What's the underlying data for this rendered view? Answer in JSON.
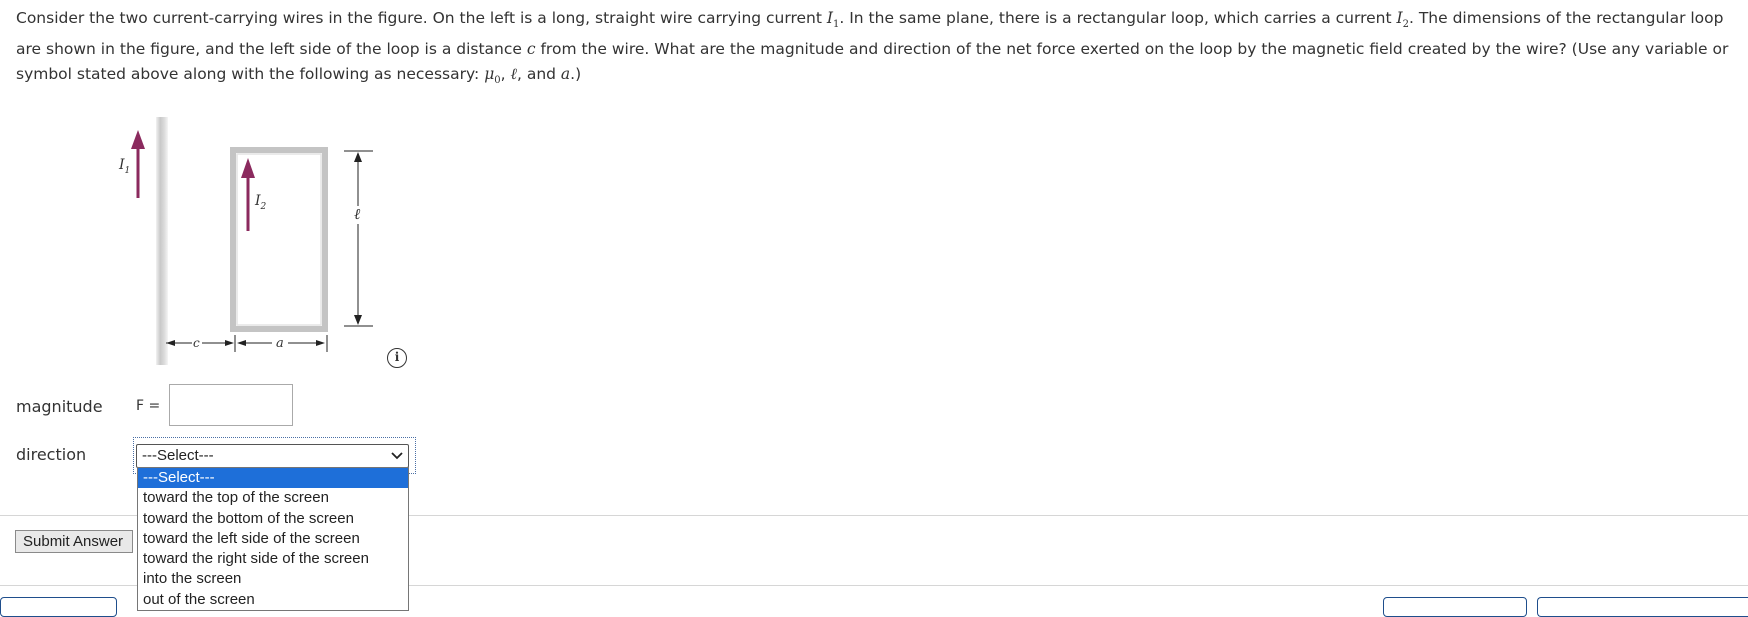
{
  "question": {
    "p1": "Consider the two current-carrying wires in the figure. On the left is a long, straight wire carrying current ",
    "i1_var": "I",
    "i1_sub": "1",
    "p2": ". In the same plane, there is a rectangular loop, which carries a current ",
    "i2_var": "I",
    "i2_sub": "2",
    "p3": ". The dimensions of the rectangular loop are shown in the figure, and the left side of the loop is a distance ",
    "c_var": "c",
    "p4": " from the wire. What are the magnitude and direction of the net force exerted on the loop by the magnetic field created by the wire? (Use any variable or symbol stated above along with the following as necessary: ",
    "mu_var": "μ",
    "mu_sub": "0",
    "p5": ", ",
    "ell_var": "ℓ",
    "p6": ", and ",
    "a_var": "a",
    "p7": ".)"
  },
  "figure": {
    "i1_label": "I",
    "i1_sub": "1",
    "i2_label": "I",
    "i2_sub": "2",
    "ell_label": "ℓ",
    "c_label": "c",
    "a_label": "a",
    "arrow_color": "#8b2a5e"
  },
  "info_icon": {
    "glyph": "i"
  },
  "magnitude": {
    "label": "magnitude",
    "f_label": "F =",
    "value": ""
  },
  "direction": {
    "label": "direction",
    "selected": "---Select---",
    "options": [
      "---Select---",
      "toward the top of the screen",
      "toward the bottom of the screen",
      "toward the left side of the screen",
      "toward the right side of the screen",
      "into the screen",
      "out of the screen"
    ],
    "highlight_color": "#1e6fd9"
  },
  "submit": {
    "label": "Submit Answer"
  }
}
